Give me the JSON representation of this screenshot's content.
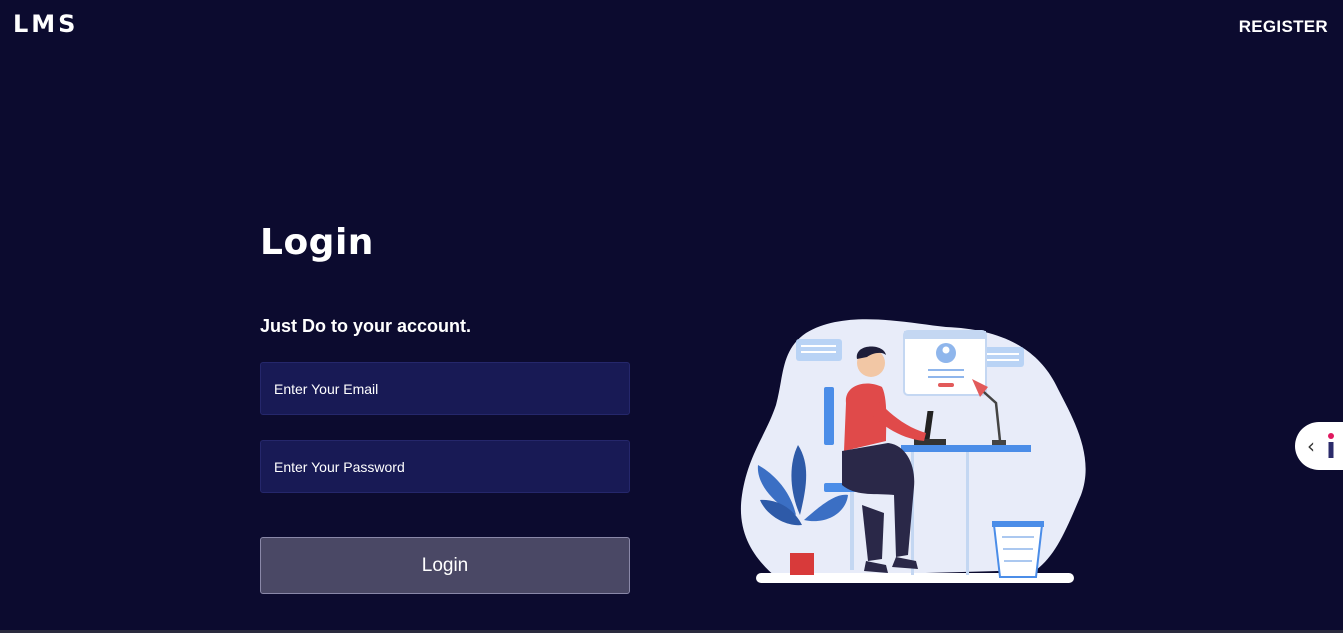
{
  "header": {
    "brand": "LMS",
    "register_label": "REGISTER"
  },
  "login": {
    "title": "Login",
    "subtitle": "Just Do to your account.",
    "email_placeholder": "Enter Your Email",
    "password_placeholder": "Enter Your Password",
    "button_label": "Login"
  },
  "side_tab": {
    "icon": "chevron-left-icon",
    "badge": "info-badge"
  },
  "colors": {
    "background": "#0c0b2f",
    "input_bg": "#181a55",
    "button_bg": "#4a4865"
  }
}
